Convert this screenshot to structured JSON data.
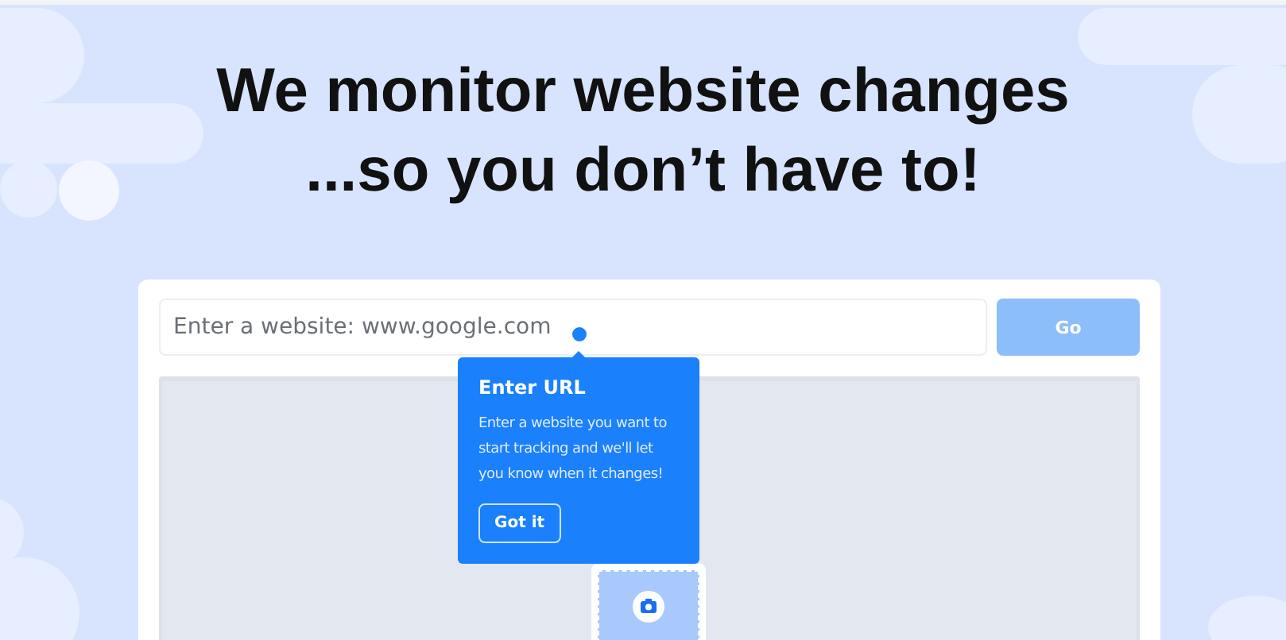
{
  "headline": [
    "We monitor website changes",
    "...so you don’t have to!"
  ],
  "url_form": {
    "placeholder": "Enter a website: www.google.com",
    "button": "Go"
  },
  "tooltip": {
    "title": "Enter URL",
    "text": "Enter a website you want to start tracking and we'll let you know when it changes!",
    "button": "Got it"
  }
}
